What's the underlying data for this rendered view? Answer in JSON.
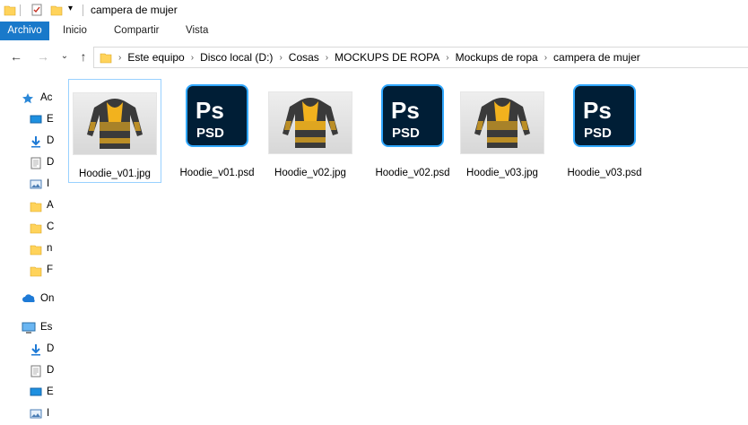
{
  "window": {
    "title": "campera de mujer"
  },
  "ribbon": {
    "tabs": [
      "Archivo",
      "Inicio",
      "Compartir",
      "Vista"
    ]
  },
  "address": {
    "crumbs": [
      "Este equipo",
      "Disco local (D:)",
      "Cosas",
      "MOCKUPS DE ROPA",
      "Mockups de ropa",
      "campera de mujer"
    ]
  },
  "nav": {
    "items": [
      {
        "label": "Ac",
        "icon": "star-icon"
      },
      {
        "label": "E",
        "icon": "desktop-icon"
      },
      {
        "label": "D",
        "icon": "download-icon"
      },
      {
        "label": "D",
        "icon": "document-icon"
      },
      {
        "label": "I",
        "icon": "image-icon"
      },
      {
        "label": "A",
        "icon": "folder-icon"
      },
      {
        "label": "C",
        "icon": "folder-icon"
      },
      {
        "label": "n",
        "icon": "folder-icon"
      },
      {
        "label": "F",
        "icon": "folder-icon"
      },
      {
        "label": "On",
        "icon": "onedrive-icon"
      },
      {
        "label": "Es",
        "icon": "computer-icon"
      },
      {
        "label": "D",
        "icon": "download-icon"
      },
      {
        "label": "D",
        "icon": "document-icon"
      },
      {
        "label": "E",
        "icon": "desktop-icon"
      },
      {
        "label": "I",
        "icon": "image-icon"
      }
    ]
  },
  "files": [
    {
      "name": "Hoodie_v01.jpg",
      "type": "jpg"
    },
    {
      "name": "Hoodie_v01.psd",
      "type": "psd"
    },
    {
      "name": "Hoodie_v02.jpg",
      "type": "jpg"
    },
    {
      "name": "Hoodie_v02.psd",
      "type": "psd"
    },
    {
      "name": "Hoodie_v03.jpg",
      "type": "jpg"
    },
    {
      "name": "Hoodie_v03.psd",
      "type": "psd"
    }
  ],
  "psd_icon": {
    "label": "Ps",
    "sub": "PSD"
  },
  "colors": {
    "accent": "#1979ca",
    "psd_bg": "#001e36",
    "psd_border": "#31a8ff",
    "hoodie_yellow": "#f2b21e",
    "hoodie_dark": "#3a3a3a",
    "folder": "#ffd35b"
  }
}
